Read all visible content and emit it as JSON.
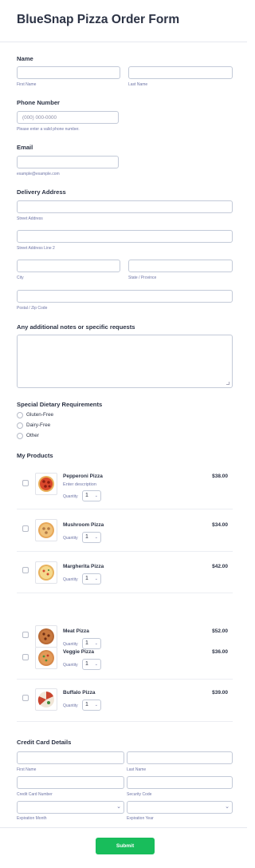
{
  "form": {
    "title": "BlueSnap Pizza Order Form"
  },
  "name": {
    "label": "Name",
    "first": "First Name",
    "last": "Last Name"
  },
  "phone": {
    "label": "Phone Number",
    "placeholder": "(000) 000-0000",
    "hint": "Please enter a valid phone number."
  },
  "email": {
    "label": "Email",
    "hint": "example@example.com"
  },
  "address": {
    "label": "Delivery Address",
    "street": "Street Address",
    "street2": "Street Address Line 2",
    "city": "City",
    "state": "State / Province",
    "zip": "Postal / Zip Code"
  },
  "notes": {
    "label": "Any additional notes or specific requests"
  },
  "dietary": {
    "label": "Special Dietary Requirements",
    "options": [
      "Gluten-Free",
      "Dairy-Free",
      "Other"
    ]
  },
  "products": {
    "label": "My Products",
    "quantity_label": "Quantity",
    "items": [
      {
        "name": "Pepperoni Pizza",
        "desc": "Enter description",
        "price": "$38.00",
        "qty": "1"
      },
      {
        "name": "Mushroom Pizza",
        "price": "$34.00",
        "qty": "1"
      },
      {
        "name": "Margherita Pizza",
        "price": "$42.00",
        "qty": "1"
      },
      {
        "name": "Meat Pizza",
        "price": "$52.00",
        "qty": "1"
      },
      {
        "name": "Veggie Pizza",
        "price": "$36.00",
        "qty": "1"
      },
      {
        "name": "Buffalo Pizza",
        "price": "$39.00",
        "qty": "1"
      }
    ]
  },
  "card": {
    "label": "Credit Card Details",
    "first": "First Name",
    "last": "Last Name",
    "number": "Credit Card Number",
    "code": "Security Code",
    "month": "Expiration Month",
    "year": "Expiration Year"
  },
  "submit": {
    "label": "Submit"
  },
  "colors": {
    "accent": "#18bd5b",
    "text": "#2c3345",
    "muted": "#6f76a7",
    "border": "#c3cad8"
  }
}
